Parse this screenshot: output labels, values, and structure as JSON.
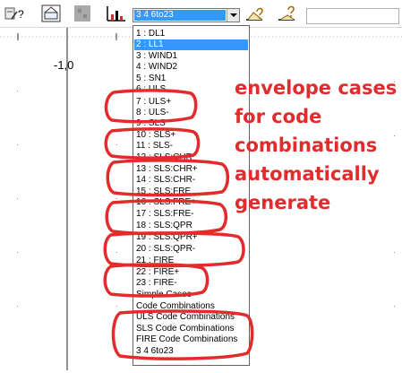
{
  "toolbar": {
    "combo_value": "3 4 6to23",
    "right_field_value": ""
  },
  "canvas": {
    "axis_label": "-1,0"
  },
  "dropdown": {
    "items": [
      {
        "label": "1 : DL1",
        "selected": false
      },
      {
        "label": "2 : LL1",
        "selected": true
      },
      {
        "label": "3 : WIND1",
        "selected": false
      },
      {
        "label": "4 : WIND2",
        "selected": false
      },
      {
        "label": "5 : SN1",
        "selected": false
      },
      {
        "label": "6 : ULS",
        "selected": false
      },
      {
        "label": "7 : ULS+",
        "selected": false
      },
      {
        "label": "8 : ULS-",
        "selected": false
      },
      {
        "label": "9 : SLS",
        "selected": false
      },
      {
        "label": "10 : SLS+",
        "selected": false
      },
      {
        "label": "11 : SLS-",
        "selected": false
      },
      {
        "label": "12 : SLS:CHR",
        "selected": false
      },
      {
        "label": "13 : SLS:CHR+",
        "selected": false
      },
      {
        "label": "14 : SLS:CHR-",
        "selected": false
      },
      {
        "label": "15 : SLS:FRE",
        "selected": false
      },
      {
        "label": "16 : SLS:FRE+",
        "selected": false
      },
      {
        "label": "17 : SLS:FRE-",
        "selected": false
      },
      {
        "label": "18 : SLS:QPR",
        "selected": false
      },
      {
        "label": "19 : SLS:QPR+",
        "selected": false
      },
      {
        "label": "20 : SLS:QPR-",
        "selected": false
      },
      {
        "label": "21 : FIRE",
        "selected": false
      },
      {
        "label": "22 : FIRE+",
        "selected": false
      },
      {
        "label": "23 : FIRE-",
        "selected": false
      },
      {
        "label": "Simple Cases",
        "selected": false
      },
      {
        "label": "Code Combinations",
        "selected": false
      },
      {
        "label": "ULS Code Combinations",
        "selected": false
      },
      {
        "label": "SLS Code Combinations",
        "selected": false
      },
      {
        "label": "FIRE Code Combinations",
        "selected": false
      },
      {
        "label": "3 4 6to23",
        "selected": false
      }
    ]
  },
  "annotation": {
    "lines": [
      "envelope cases",
      "for code",
      "combinations",
      "automatically",
      "generate"
    ],
    "color": "#e32b2b"
  },
  "colors": {
    "selection": "#3399ff",
    "annotation": "#e32b2b"
  },
  "icons": [
    "calculator-help-icon",
    "frame-view-icon",
    "disabled-grid-icon",
    "load-chart-icon",
    "combo-dropdown-arrow-icon",
    "load-case-up-icon",
    "load-case-down-icon"
  ]
}
